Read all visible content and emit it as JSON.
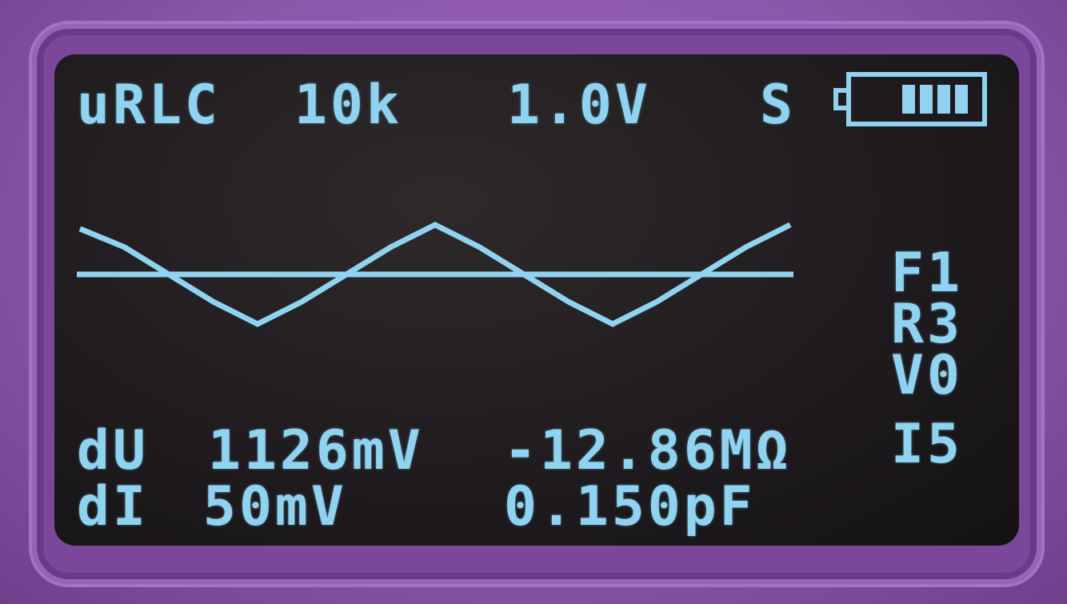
{
  "status_bar": {
    "mode": "uRLC",
    "frequency": "10k",
    "voltage": "1.0V",
    "range": "S",
    "battery_level": 4,
    "battery_max": 4
  },
  "side_labels": [
    "F1",
    "R3",
    "V0",
    "I5"
  ],
  "readings": {
    "du_label": "dU",
    "du_value": "1126mV",
    "resistance": "-12.86MΩ",
    "di_label": "dI",
    "di_value": "50mV",
    "capacitance": "0.150pF"
  },
  "waveform": {
    "color": "#8fd3f0",
    "description_points_y": [
      0.92,
      0.55,
      0.0,
      -0.55,
      -1.0,
      -0.55,
      0.0,
      0.55,
      1.0,
      0.55,
      0.0,
      -0.55,
      -1.0,
      -0.55,
      0.0,
      0.55,
      1.0
    ]
  },
  "colors": {
    "lcd_text": "#8fd3f0",
    "lcd_background": "#1e1a1d",
    "case": "#8c58ab"
  }
}
